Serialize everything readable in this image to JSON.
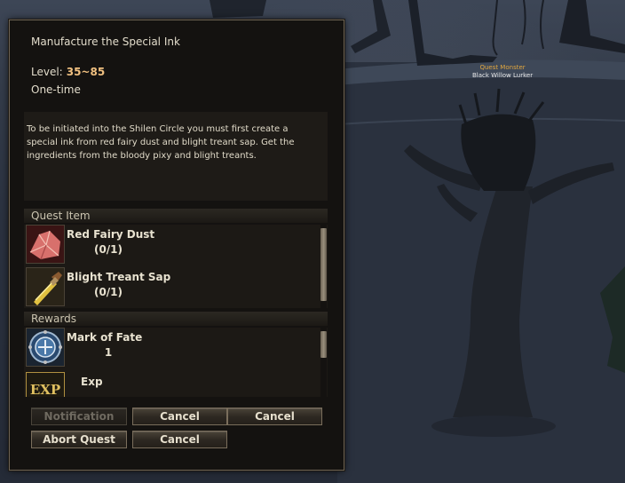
{
  "quest": {
    "title": "Manufacture the Special Ink",
    "level_label": "Level:",
    "level_range": "35~85",
    "repeat_type": "One-time",
    "description": "To be initiated into the Shilen Circle you must first create a special ink from red fairy dust and blight treant sap. Get the ingredients from the bloody pixy and blight treants.",
    "items_header": "Quest Item",
    "items": [
      {
        "name": "Red Fairy Dust",
        "count": "(0/1)",
        "icon": "red-crystal-icon"
      },
      {
        "name": "Blight Treant Sap",
        "count": "(0/1)",
        "icon": "potion-vial-icon"
      }
    ],
    "items_scroll_fraction": 0.85,
    "rewards_header": "Rewards",
    "rewards": [
      {
        "name": "Mark of Fate",
        "count": "1",
        "icon": "mark-of-fate-icon"
      },
      {
        "name": "Exp",
        "count": "",
        "icon": "exp-icon",
        "icon_text": "EXP"
      }
    ]
  },
  "buttons": {
    "notification": "Notification",
    "cancel_1": "Cancel",
    "cancel_2": "Cancel",
    "abort": "Abort Quest",
    "cancel_3": "Cancel"
  },
  "world": {
    "monster_tag": "Quest Monster",
    "monster_name": "Black Willow Lurker"
  },
  "colors": {
    "level_highlight": "#f0c080",
    "quest_tag": "#e0a640"
  }
}
